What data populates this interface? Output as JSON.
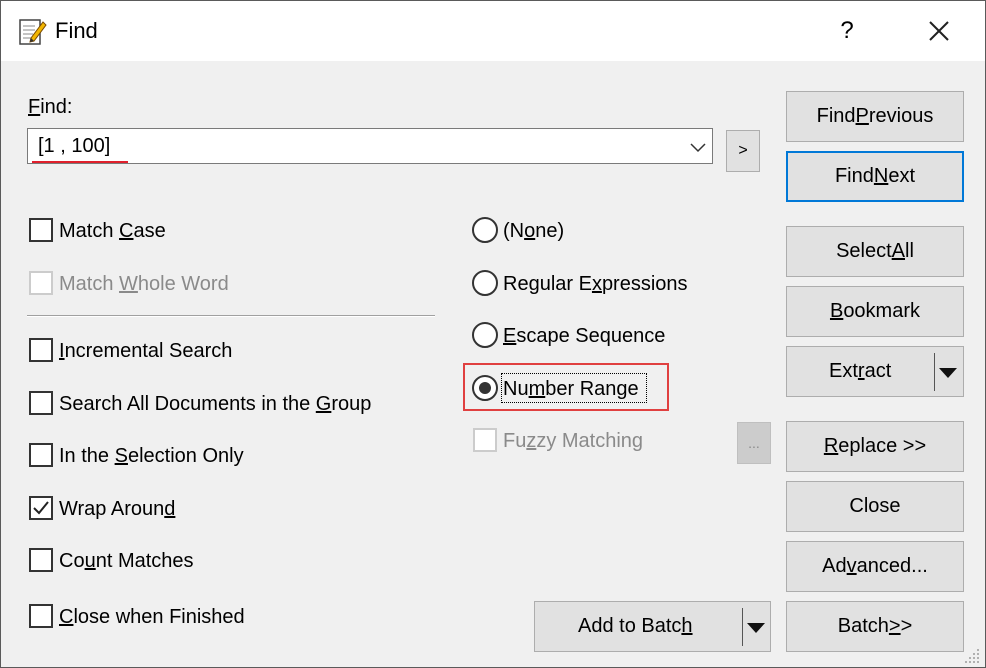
{
  "window": {
    "title": "Find",
    "help": "?",
    "close": "✕"
  },
  "find": {
    "label_u": "F",
    "label_rest": "ind:",
    "value": "[1 , 100]",
    "expand": ">"
  },
  "options_left": [
    {
      "pre": "Match ",
      "u": "C",
      "post": "ase",
      "checked": false,
      "enabled": true
    },
    {
      "pre": "Match ",
      "u": "W",
      "post": "hole Word",
      "checked": false,
      "enabled": false
    },
    {
      "pre": "",
      "u": "I",
      "post": "ncremental Search",
      "checked": false,
      "enabled": true
    },
    {
      "pre": "Search All Documents in the ",
      "u": "G",
      "post": "roup",
      "checked": false,
      "enabled": true
    },
    {
      "pre": "In the ",
      "u": "S",
      "post": "election Only",
      "checked": false,
      "enabled": true
    },
    {
      "pre": "Wrap Aroun",
      "u": "d",
      "post": "",
      "checked": true,
      "enabled": true
    },
    {
      "pre": "Co",
      "u": "u",
      "post": "nt Matches",
      "checked": false,
      "enabled": true
    },
    {
      "pre": "",
      "u": "C",
      "post": "lose when Finished",
      "checked": false,
      "enabled": true
    }
  ],
  "modes": [
    {
      "pre": "(N",
      "u": "o",
      "post": "ne)",
      "selected": false
    },
    {
      "pre": "Regular E",
      "u": "x",
      "post": "pressions",
      "selected": false
    },
    {
      "pre": "",
      "u": "E",
      "post": "scape Sequence",
      "selected": false
    },
    {
      "pre": "Nu",
      "u": "m",
      "post": "ber Range",
      "selected": true
    }
  ],
  "fuzzy": {
    "pre": "Fu",
    "u": "z",
    "post": "zy Matching",
    "checked": false,
    "enabled": false,
    "more": "..."
  },
  "buttons": {
    "find_previous": {
      "pre": "Find ",
      "u": "P",
      "post": "revious"
    },
    "find_next": {
      "pre": "Find ",
      "u": "N",
      "post": "ext"
    },
    "select_all": {
      "pre": "Select ",
      "u": "A",
      "post": "ll"
    },
    "bookmark": {
      "pre": "",
      "u": "B",
      "post": "ookmark"
    },
    "extract": {
      "pre": "Ext",
      "u": "r",
      "post": "act"
    },
    "replace": {
      "pre": "",
      "u": "R",
      "post": "eplace >>"
    },
    "close": {
      "pre": "Close",
      "u": "",
      "post": ""
    },
    "advanced": {
      "pre": "Ad",
      "u": "v",
      "post": "anced..."
    },
    "batch": {
      "pre": "Batch ",
      "u": ">",
      "post": ">"
    },
    "add_to_batch": {
      "pre": "Add to Batc",
      "u": "h",
      "post": ""
    }
  },
  "colors": {
    "accent": "#0078d7",
    "highlight": "#e04040",
    "spellcheck": "#e0202c"
  }
}
